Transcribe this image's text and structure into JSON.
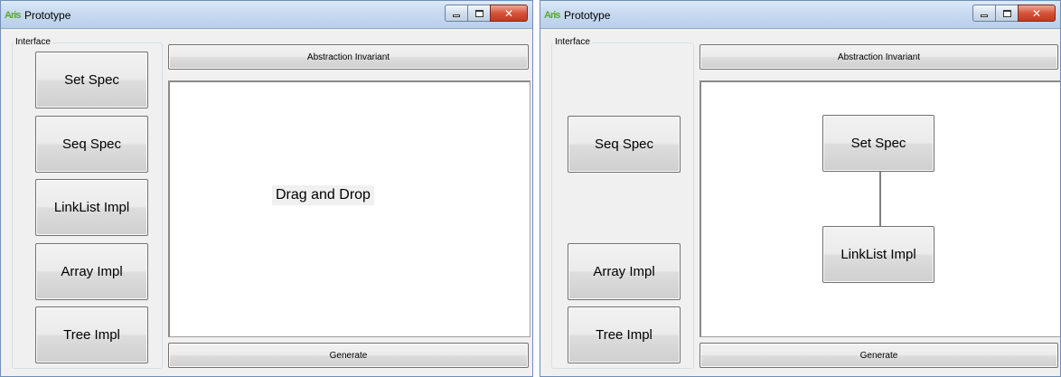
{
  "windows": [
    {
      "title": "Prototype",
      "app_icon": "Aris",
      "group_label": "Interface",
      "palette": [
        "Set Spec",
        "Seq Spec",
        "LinkList Impl",
        "Array Impl",
        "Tree Impl"
      ],
      "top_button": "Abstraction Invariant",
      "canvas_hint": "Drag and Drop",
      "bottom_button": "Generate"
    },
    {
      "title": "Prototype",
      "app_icon": "Aris",
      "group_label": "Interface",
      "palette": [
        "Seq Spec",
        "Array Impl",
        "Tree Impl"
      ],
      "top_button": "Abstraction Invariant",
      "canvas_nodes": [
        "Set Spec",
        "LinkList Impl"
      ],
      "bottom_button": "Generate"
    }
  ],
  "caption": {
    "close_glyph": "✕"
  },
  "icons": [
    "app-icon",
    "minimize-icon",
    "maximize-icon",
    "close-icon"
  ],
  "colors": {
    "title_bar": "#c7daf0",
    "close_button": "#d7533a",
    "canvas": "#ffffff"
  }
}
